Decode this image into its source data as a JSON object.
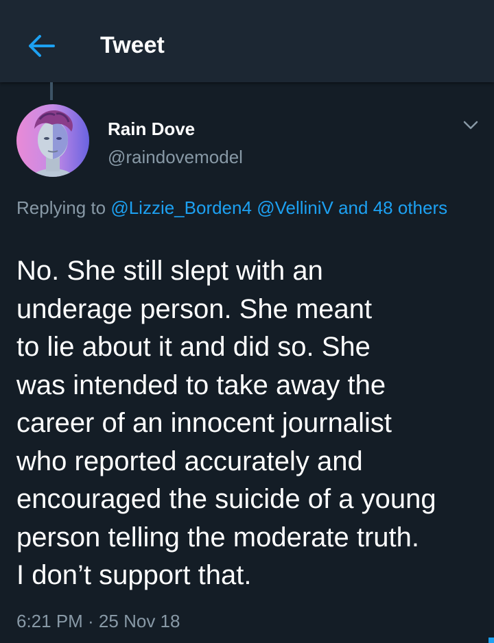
{
  "header": {
    "title": "Tweet",
    "back_icon": "back-arrow-icon",
    "accent_color": "#1da1f2"
  },
  "tweet": {
    "author": {
      "display_name": "Rain Dove",
      "handle": "@raindovemodel"
    },
    "reply": {
      "prefix": "Replying to",
      "mentions": [
        "@Lizzie_Borden4",
        "@VelliniV"
      ],
      "others": "and 48 others"
    },
    "text": "No. She still slept with an\nunderage person. She meant\nto lie about it and did so. She\nwas intended to take away the\ncareer of an innocent journalist\nwho reported accurately and\nencouraged the suicide of a young\nperson telling the moderate truth.\nI don’t support that.",
    "timestamp": "6:21 PM · 25 Nov 18",
    "menu_icon": "chevron-down-icon"
  },
  "colors": {
    "background": "#141d26",
    "header_background": "#1c2733",
    "secondary_text": "#8899a6",
    "link": "#1da1f2"
  }
}
